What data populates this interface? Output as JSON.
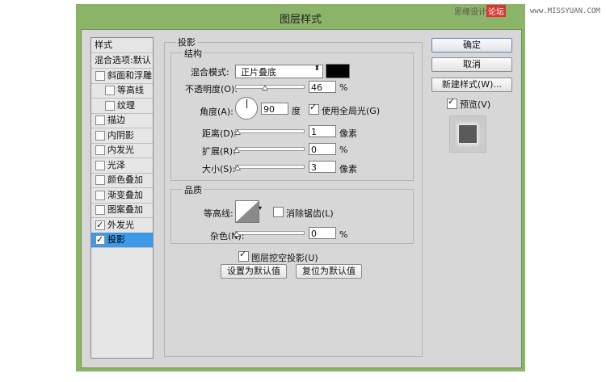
{
  "window": {
    "title": "图层样式"
  },
  "watermark": {
    "text": "思缘设计",
    "highlight": "论坛",
    "url": "www.MISSYUAN.COM"
  },
  "sidebar": {
    "header": "样式",
    "items": [
      {
        "label": "混合选项:默认",
        "checkbox": false,
        "checked": false,
        "sub": false,
        "active": false
      },
      {
        "label": "斜面和浮雕",
        "checkbox": true,
        "checked": false,
        "sub": false,
        "active": false
      },
      {
        "label": "等高线",
        "checkbox": true,
        "checked": false,
        "sub": true,
        "active": false
      },
      {
        "label": "纹理",
        "checkbox": true,
        "checked": false,
        "sub": true,
        "active": false
      },
      {
        "label": "描边",
        "checkbox": true,
        "checked": false,
        "sub": false,
        "active": false
      },
      {
        "label": "内阴影",
        "checkbox": true,
        "checked": false,
        "sub": false,
        "active": false
      },
      {
        "label": "内发光",
        "checkbox": true,
        "checked": false,
        "sub": false,
        "active": false
      },
      {
        "label": "光泽",
        "checkbox": true,
        "checked": false,
        "sub": false,
        "active": false
      },
      {
        "label": "颜色叠加",
        "checkbox": true,
        "checked": false,
        "sub": false,
        "active": false
      },
      {
        "label": "渐变叠加",
        "checkbox": true,
        "checked": false,
        "sub": false,
        "active": false
      },
      {
        "label": "图案叠加",
        "checkbox": true,
        "checked": false,
        "sub": false,
        "active": false
      },
      {
        "label": "外发光",
        "checkbox": true,
        "checked": true,
        "sub": false,
        "active": false
      },
      {
        "label": "投影",
        "checkbox": true,
        "checked": true,
        "sub": false,
        "active": true
      }
    ]
  },
  "drop_shadow": {
    "section_title": "投影",
    "structure": {
      "title": "结构",
      "blend_mode_label": "混合模式:",
      "blend_mode_value": "正片叠底",
      "color": "#000000",
      "opacity_label": "不透明度(O):",
      "opacity_value": "46",
      "opacity_unit": "%",
      "angle_label": "角度(A):",
      "angle_value": "90",
      "angle_unit": "度",
      "global_light_label": "使用全局光(G)",
      "global_light_checked": true,
      "distance_label": "距离(D):",
      "distance_value": "1",
      "distance_unit": "像素",
      "spread_label": "扩展(R):",
      "spread_value": "0",
      "spread_unit": "%",
      "size_label": "大小(S):",
      "size_value": "3",
      "size_unit": "像素"
    },
    "quality": {
      "title": "品质",
      "contour_label": "等高线:",
      "antialias_label": "消除锯齿(L)",
      "antialias_checked": false,
      "noise_label": "杂色(N):",
      "noise_value": "0",
      "noise_unit": "%"
    },
    "knockout_label": "图层挖空投影(U)",
    "knockout_checked": true,
    "make_default_label": "设置为默认值",
    "reset_default_label": "复位为默认值"
  },
  "actions": {
    "ok_label": "确定",
    "cancel_label": "取消",
    "new_style_label": "新建样式(W)...",
    "preview_label": "预览(V)",
    "preview_checked": true
  }
}
